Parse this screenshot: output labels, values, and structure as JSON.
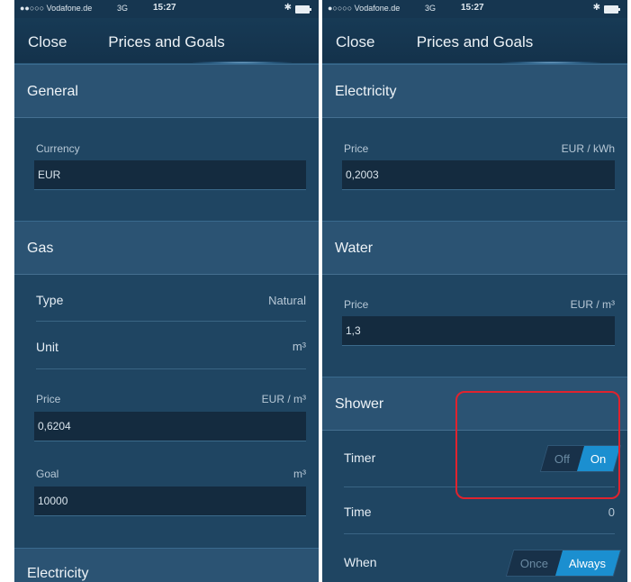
{
  "status_bar": {
    "left": {
      "carrier": "●●○○○ Vodafone.de",
      "network": "3G",
      "time": "15:27"
    },
    "right": {
      "carrier": "●○○○○ Vodafone.de",
      "network": "3G",
      "time": "15:27"
    }
  },
  "navbar": {
    "close_label": "Close",
    "title": "Prices and Goals"
  },
  "left_screen": {
    "general": {
      "header": "General",
      "currency_label": "Currency",
      "currency_value": "EUR"
    },
    "gas": {
      "header": "Gas",
      "type_label": "Type",
      "type_value": "Natural",
      "unit_label": "Unit",
      "unit_value": "m³",
      "price_label": "Price",
      "price_unit": "EUR / m³",
      "price_value": "0,6204",
      "goal_label": "Goal",
      "goal_unit": "m³",
      "goal_value": "10000"
    },
    "electricity_header": "Electricity"
  },
  "right_screen": {
    "electricity": {
      "header": "Electricity",
      "price_label": "Price",
      "price_unit": "EUR / kWh",
      "price_value": "0,2003"
    },
    "water": {
      "header": "Water",
      "price_label": "Price",
      "price_unit": "EUR / m³",
      "price_value": "1,3"
    },
    "shower": {
      "header": "Shower",
      "timer_label": "Timer",
      "timer_off": "Off",
      "timer_on": "On",
      "timer_selected": "On",
      "time_label": "Time",
      "time_value": "0",
      "when_label": "When",
      "when_once": "Once",
      "when_always": "Always",
      "when_selected": "Always"
    }
  },
  "colors": {
    "accent": "#1b8fd0",
    "background": "#1f4562",
    "highlight": "#e0232e"
  },
  "icons": [
    "bluetooth-icon",
    "battery-icon"
  ]
}
